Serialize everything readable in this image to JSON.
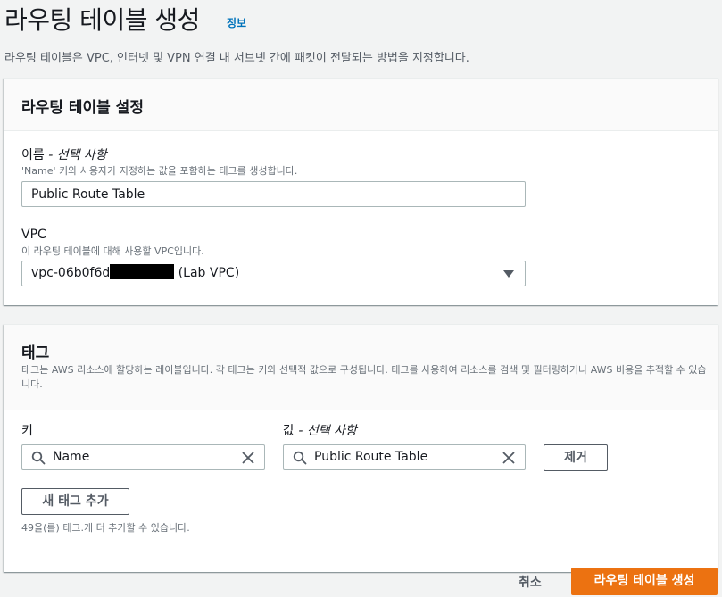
{
  "header": {
    "title": "라우팅 테이블 생성",
    "info_link": "정보",
    "description": "라우팅 테이블은 VPC, 인터넷 및 VPN 연결 내 서브넷 간에 패킷이 전달되는 방법을 지정합니다."
  },
  "settings": {
    "title": "라우팅 테이블 설정",
    "name_field": {
      "label": "이름",
      "optional": " - 선택 사항",
      "description": "'Name' 키와 사용자가 지정하는 값을 포함하는 태그를 생성합니다.",
      "value": "Public Route Table"
    },
    "vpc_field": {
      "label": "VPC",
      "description": "이 라우팅 테이블에 대해 사용할 VPC입니다.",
      "value_prefix": "vpc-06b0f6d",
      "value_suffix": " (Lab VPC)"
    }
  },
  "tags": {
    "title": "태그",
    "description": "태그는 AWS 리소스에 할당하는 레이블입니다. 각 태그는 키와 선택적 값으로 구성됩니다. 태그를 사용하여 리소스를 검색 및 필터링하거나 AWS 비용을 추적할 수 있습니다.",
    "key_label": "키",
    "value_label": "값",
    "value_optional": " - 선택 사항",
    "rows": [
      {
        "key": "Name",
        "value": "Public Route Table",
        "remove_label": "제거"
      }
    ],
    "add_button": "새 태그 추가",
    "remaining_note": "49을(를) 태그.개 더 추가할 수 있습니다."
  },
  "footer": {
    "cancel_label": "취소",
    "create_label": "라우팅 테이블 생성"
  },
  "colors": {
    "primary": "#ec7211",
    "link": "#0073bb"
  }
}
